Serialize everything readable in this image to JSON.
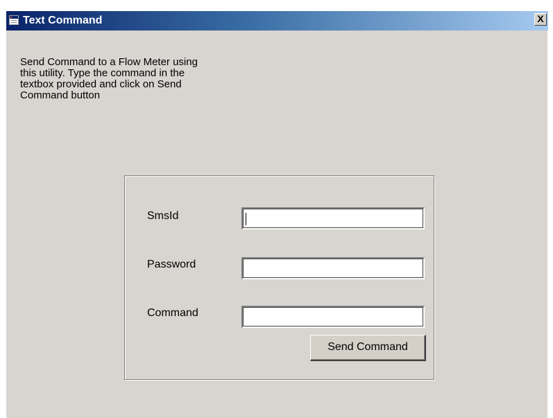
{
  "window": {
    "title": "Text Command",
    "close_label": "X"
  },
  "description": "Send Command to a Flow Meter using this utility. Type the command in the textbox provided and click on Send Command button",
  "form": {
    "fields": [
      {
        "label": "SmsId",
        "value": ""
      },
      {
        "label": "Password",
        "value": ""
      },
      {
        "label": "Command",
        "value": ""
      }
    ],
    "submit_label": "Send Command"
  },
  "colors": {
    "titlebar_start": "#0a246a",
    "titlebar_end": "#a6caf0",
    "window_bg": "#d8d4d0"
  },
  "icons": {
    "window_icon": "application-window-icon",
    "close": "close-icon"
  }
}
